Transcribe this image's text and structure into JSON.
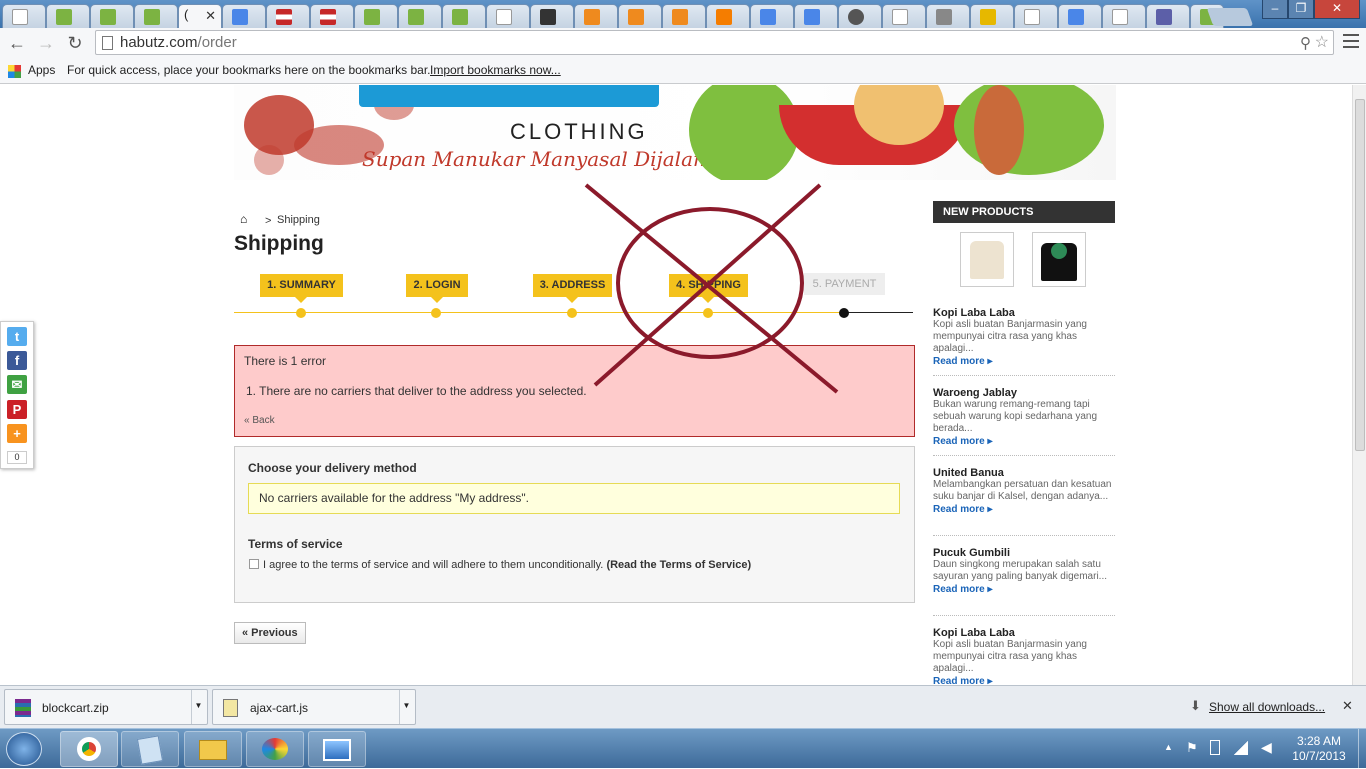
{
  "browser": {
    "active_tab_glyph": "(",
    "url_host": "habutz.com",
    "url_path": "/order",
    "bookmarks_apps": "Apps",
    "bookmarks_hint": "For quick access, place your bookmarks here on the bookmarks bar.",
    "bookmarks_import": "Import bookmarks now..."
  },
  "banner": {
    "brand_sub": "CLOTHING",
    "tagline": "Supan Manukar Manyasal Dijalan"
  },
  "breadcrumb": {
    "separator": ">",
    "current": "Shipping"
  },
  "page_title": "Shipping",
  "steps": [
    "1. SUMMARY",
    "2. LOGIN",
    "3. ADDRESS",
    "4. SHIPPING",
    "5. PAYMENT"
  ],
  "error": {
    "heading": "There is 1 error",
    "item": "1.  There are no carriers that deliver to the address you selected.",
    "back": "« Back"
  },
  "delivery": {
    "heading": "Choose your delivery method",
    "warning": "No carriers available for the address \"My address\".",
    "tos_heading": "Terms of service",
    "tos_text": "I agree to the terms of service and will adhere to them unconditionally.",
    "tos_link": "(Read the Terms of Service)"
  },
  "previous_button": "« Previous",
  "new_products": {
    "heading": "NEW PRODUCTS",
    "items": [
      {
        "title": "Kopi Laba Laba",
        "desc": "Kopi asli buatan Banjarmasin yang mempunyai citra rasa yang khas apalagi...",
        "more": "Read more"
      },
      {
        "title": "Waroeng Jablay",
        "desc": "Bukan warung remang-remang tapi sebuah warung kopi sedarhana yang berada...",
        "more": "Read more"
      },
      {
        "title": "United Banua",
        "desc": "Melambangkan persatuan dan kesatuan suku banjar di Kalsel, dengan adanya...",
        "more": "Read more"
      },
      {
        "title": "Pucuk Gumbili",
        "desc": "Daun singkong merupakan salah satu sayuran yang paling banyak digemari...",
        "more": "Read more"
      },
      {
        "title": "Kopi Laba Laba",
        "desc": "Kopi asli buatan Banjarmasin yang mempunyai citra rasa yang khas apalagi...",
        "more": "Read more"
      }
    ]
  },
  "social": {
    "count": "0"
  },
  "downloads": {
    "items": [
      "blockcart.zip",
      "ajax-cart.js"
    ],
    "show_all": "Show all downloads..."
  },
  "taskbar": {
    "time": "3:28 AM",
    "date": "10/7/2013"
  },
  "colors": {
    "step_active": "#f4c21c",
    "error_bg": "#fecbcb",
    "cross": "#8b1a2b"
  }
}
